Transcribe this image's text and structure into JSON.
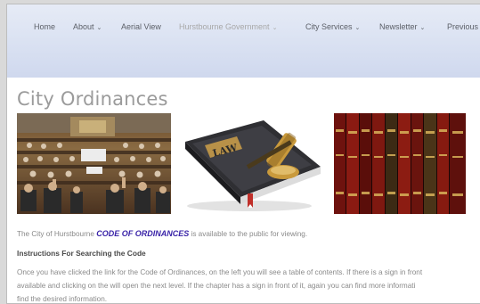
{
  "nav": {
    "items": [
      {
        "label": "Home",
        "has_dropdown": false
      },
      {
        "label": "About",
        "has_dropdown": true
      },
      {
        "label": "Aerial View",
        "has_dropdown": false
      },
      {
        "label": "Hurstbourne Government",
        "has_dropdown": true,
        "active": true
      },
      {
        "label": "City Services",
        "has_dropdown": true
      },
      {
        "label": "Newsletter",
        "has_dropdown": true
      },
      {
        "label": "Previous",
        "has_dropdown": false
      }
    ],
    "dropdown_icon": "chevron-down-icon"
  },
  "page": {
    "title": "City Ordinances",
    "images": [
      {
        "name": "assembly-photo",
        "alt": "legislative assembly chamber"
      },
      {
        "name": "law-book-gavel",
        "alt": "law book with gavel",
        "book_text": "LAW"
      },
      {
        "name": "law-books-shelf",
        "alt": "shelf of law books"
      }
    ],
    "intro_prefix": "The City of Hurstbourne ",
    "intro_link": "CODE OF ORDINANCES",
    "intro_suffix": " is available to the public for viewing.",
    "instructions_heading": "Instructions For Searching the Code",
    "instructions_line1": "Once you have clicked the link for the Code of Ordinances, on the left you will see a table of contents. If there is a sign in front",
    "instructions_line2": "available and clicking on the will open the next level. If the chapter has a sign in front of it, again you can find more informati",
    "instructions_line3": "find the desired information."
  },
  "colors": {
    "nav_background": "#dde4f3",
    "nav_text": "#5c6068",
    "nav_active_text": "#a8a8a8",
    "title_text": "#9b9b9b",
    "link": "#3a24a8"
  }
}
